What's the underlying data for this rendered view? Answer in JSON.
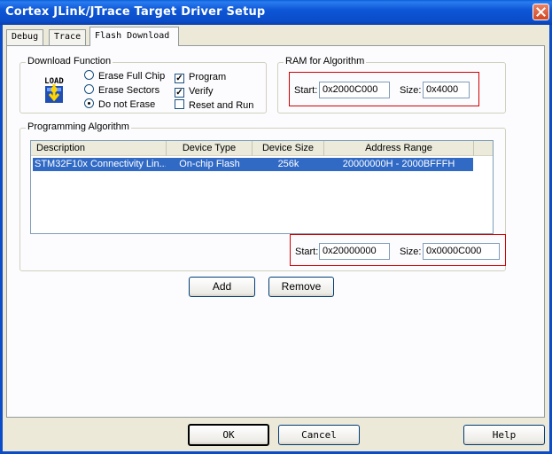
{
  "window": {
    "title": "Cortex JLink/JTrace Target Driver Setup"
  },
  "tabs": [
    {
      "label": "Debug"
    },
    {
      "label": "Trace"
    },
    {
      "label": "Flash Download"
    }
  ],
  "download_function": {
    "label": "Download Function",
    "icon_text": "LOAD",
    "radios": [
      {
        "label": "Erase Full Chip",
        "checked": false
      },
      {
        "label": "Erase Sectors",
        "checked": false
      },
      {
        "label": "Do not Erase",
        "checked": true
      }
    ],
    "checkboxes": [
      {
        "label": "Program",
        "checked": true
      },
      {
        "label": "Verify",
        "checked": true
      },
      {
        "label": "Reset and Run",
        "checked": false
      }
    ]
  },
  "ram": {
    "label": "RAM for Algorithm",
    "start_label": "Start:",
    "start_value": "0x2000C000",
    "size_label": "Size:",
    "size_value": "0x4000"
  },
  "programming": {
    "label": "Programming Algorithm",
    "columns": [
      "Description",
      "Device Type",
      "Device Size",
      "Address Range"
    ],
    "rows": [
      {
        "description": "STM32F10x Connectivity Lin...",
        "device_type": "On-chip Flash",
        "device_size": "256k",
        "address_range": "20000000H - 2000BFFFH"
      }
    ],
    "start_label": "Start:",
    "start_value": "0x20000000",
    "size_label": "Size:",
    "size_value": "0x0000C000"
  },
  "buttons": {
    "add": "Add",
    "remove": "Remove",
    "ok": "OK",
    "cancel": "Cancel",
    "help": "Help"
  },
  "colors": {
    "titlebar": "#0b4cc9",
    "selection": "#316ac5",
    "highlight_box": "#d10000",
    "dialog_bg": "#ece9d8"
  }
}
